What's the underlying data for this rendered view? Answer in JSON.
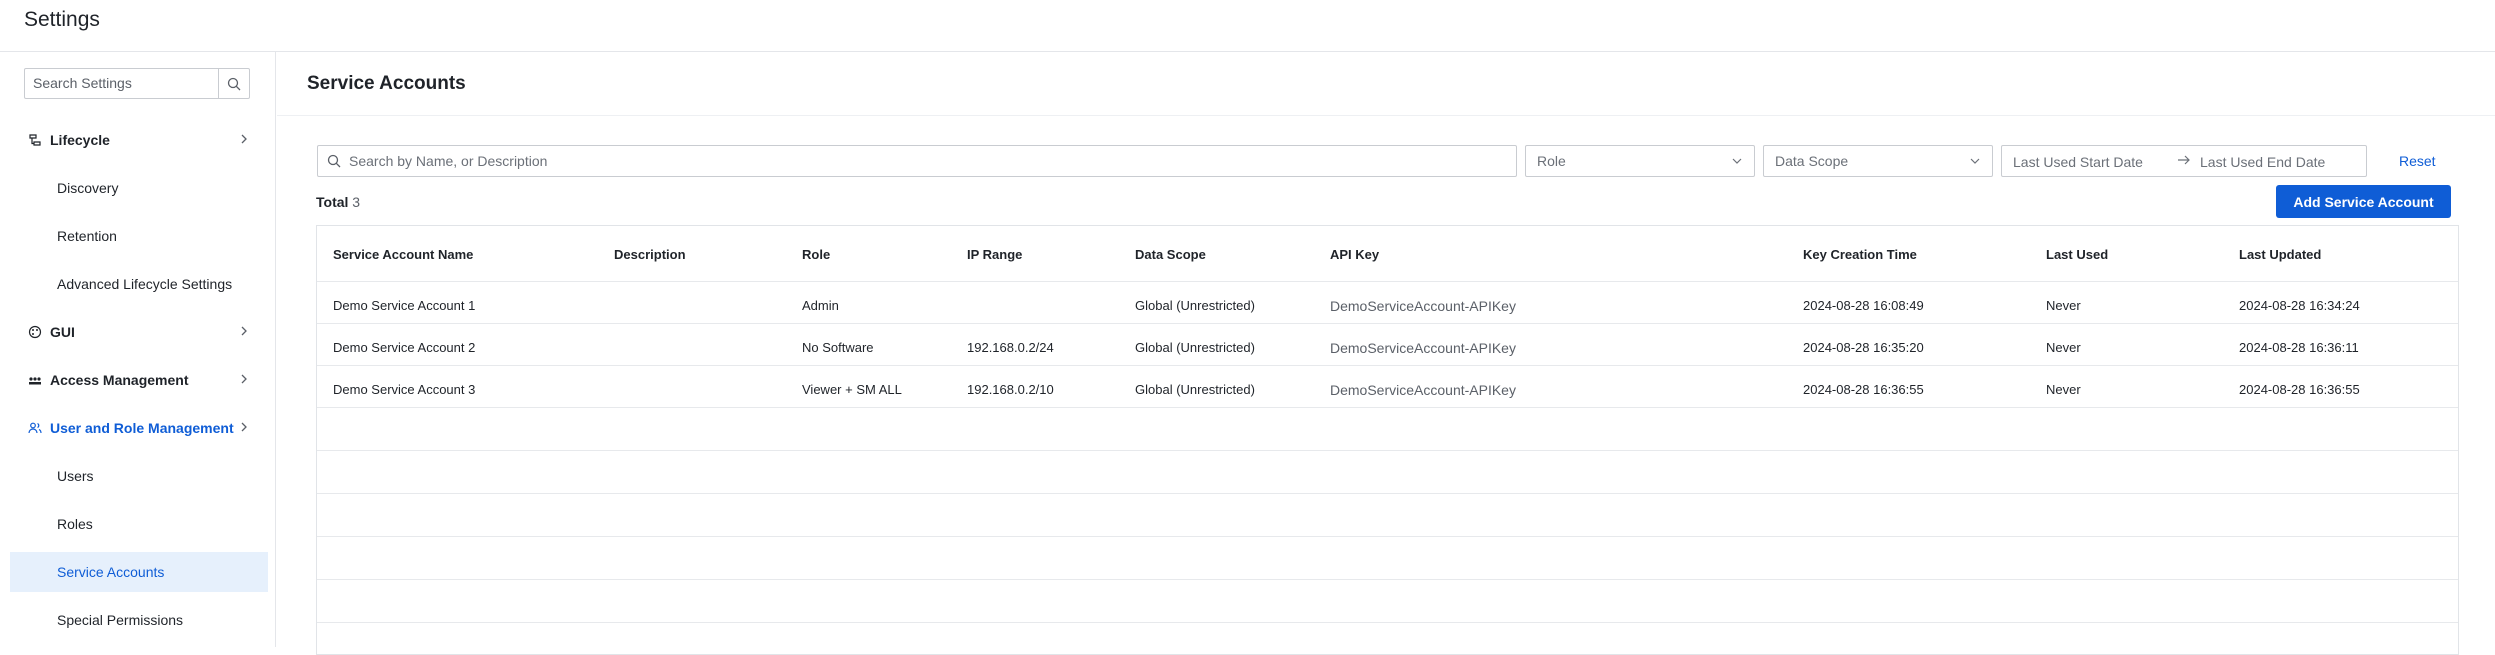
{
  "app": {
    "title": "Settings"
  },
  "sidebar": {
    "search_placeholder": "Search Settings",
    "groups": [
      {
        "label": "Lifecycle",
        "icon": "lifecycle-icon"
      },
      {
        "label": "GUI",
        "icon": "palette-icon"
      },
      {
        "label": "Access Management",
        "icon": "access-icon"
      },
      {
        "label": "User and Role Management",
        "icon": "users-icon"
      }
    ],
    "lifecycle_items": [
      "Discovery",
      "Retention",
      "Advanced Lifecycle Settings"
    ],
    "user_items": [
      "Users",
      "Roles",
      "Service Accounts",
      "Special Permissions"
    ],
    "selected": "Service Accounts",
    "accent_color": "#0f5dd6",
    "selected_bg": "#e6f0fc"
  },
  "main": {
    "title": "Service Accounts",
    "filters": {
      "search_placeholder": "Search by Name, or Description",
      "role_placeholder": "Role",
      "scope_placeholder": "Data Scope",
      "start_date_placeholder": "Last Used Start Date",
      "end_date_placeholder": "Last Used End Date",
      "reset_label": "Reset"
    },
    "total_label": "Total",
    "total_count": "3",
    "add_button": "Add Service Account",
    "table": {
      "columns": [
        "Service Account Name",
        "Description",
        "Role",
        "IP Range",
        "Data Scope",
        "API Key",
        "Key Creation Time",
        "Last Used",
        "Last Updated"
      ],
      "rows": [
        [
          "Demo Service Account 1",
          "",
          "Admin",
          "",
          "Global (Unrestricted)",
          "DemoServiceAccount-APIKey",
          "2024-08-28 16:08:49",
          "Never",
          "2024-08-28 16:34:24"
        ],
        [
          "Demo Service Account 2",
          "",
          "No Software",
          "192.168.0.2/24",
          "Global (Unrestricted)",
          "DemoServiceAccount-APIKey",
          "2024-08-28 16:35:20",
          "Never",
          "2024-08-28 16:36:11"
        ],
        [
          "Demo Service Account 3",
          "",
          "Viewer + SM ALL",
          "192.168.0.2/10",
          "Global (Unrestricted)",
          "DemoServiceAccount-APIKey",
          "2024-08-28 16:36:55",
          "Never",
          "2024-08-28 16:36:55"
        ]
      ]
    }
  }
}
